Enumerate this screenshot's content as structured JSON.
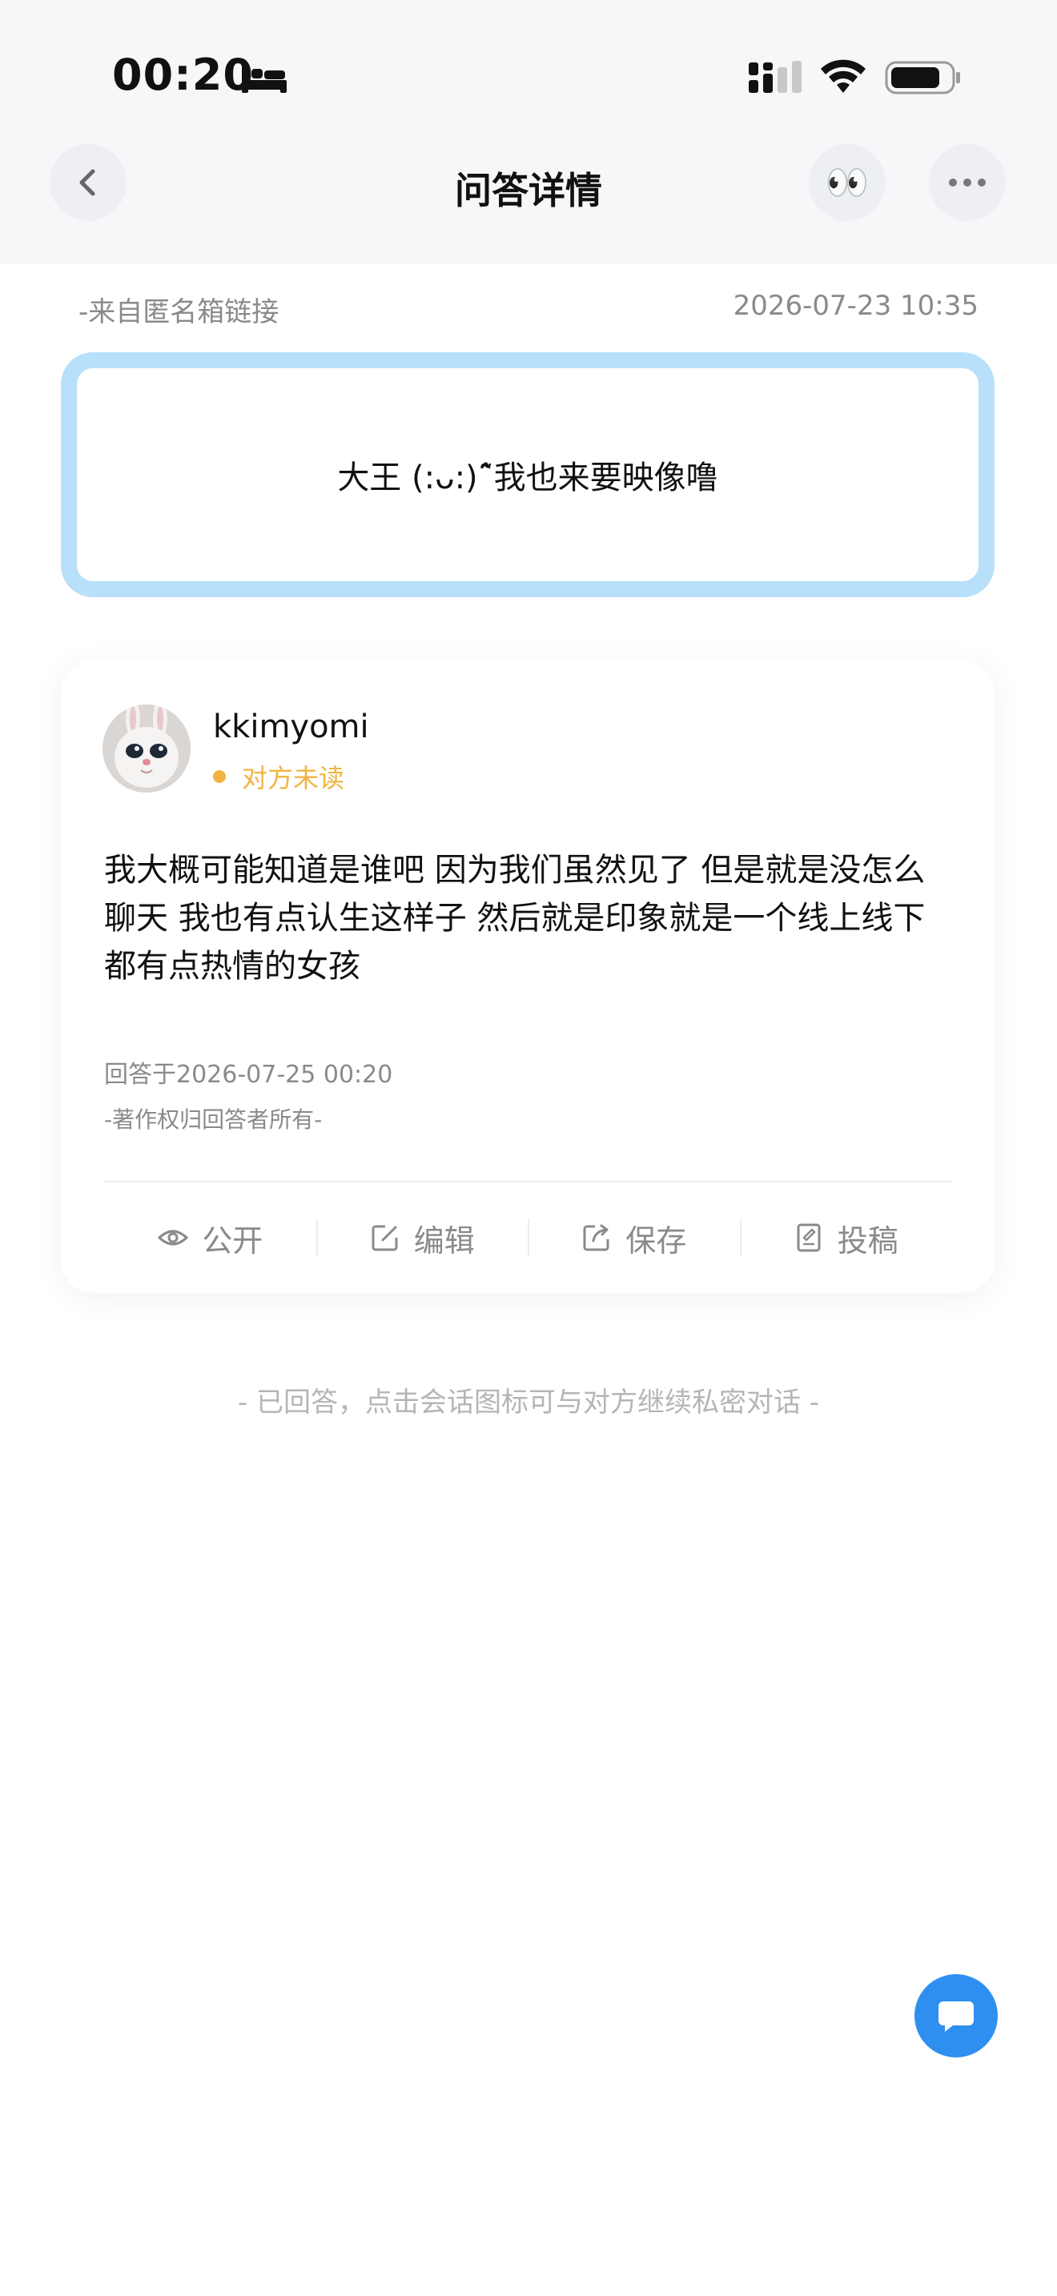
{
  "status_bar": {
    "time": "00:20"
  },
  "header": {
    "title": "问答详情",
    "eyes_emoji": "👀"
  },
  "question": {
    "source": "-来自匿名箱链接",
    "timestamp": "2026-07-23 10:35",
    "text": "大王 (:ᴗ:)˜̂我也来要映像噜"
  },
  "answer": {
    "username": "kkimyomi",
    "read_status": "对方未读",
    "text": "我大概可能知道是谁吧 因为我们虽然见了 但是就是没怎么聊天 我也有点认生这样子 然后就是印象就是一个线上线下都有点热情的女孩",
    "answered_at": "回答于2026-07-25 00:20",
    "copyright": "-著作权归回答者所有-",
    "actions": [
      {
        "icon": "eye-icon",
        "label": "公开"
      },
      {
        "icon": "edit-icon",
        "label": "编辑"
      },
      {
        "icon": "save-icon",
        "label": "保存"
      },
      {
        "icon": "submit-icon",
        "label": "投稿"
      }
    ]
  },
  "footer_note": "- 已回答，点击会话图标可与对方继续私密对话 -",
  "colors": {
    "accent": "#2f8ff0",
    "question_border": "#b8e0fa",
    "unread": "#f1b443"
  }
}
